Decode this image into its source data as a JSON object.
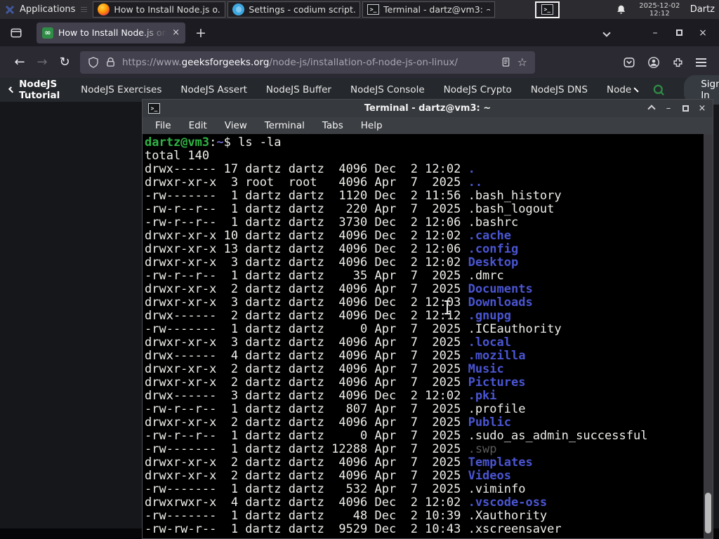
{
  "panel": {
    "applications_label": "Applications",
    "window_buttons": [
      {
        "label": "How to Install Node.js o...",
        "icon": "firefox"
      },
      {
        "label": "Settings - codium script...",
        "icon": "vscodium"
      },
      {
        "label": "Terminal - dartz@vm3: ~",
        "icon": "terminal"
      }
    ],
    "clock_date": "2025-12-02",
    "clock_time": "12:12",
    "user_label": "Dartz"
  },
  "browser": {
    "tab_title": "How to Install Node.js on",
    "url_scheme": "https://www.",
    "url_domain": "geeksforgeeks.org",
    "url_path": "/node-js/installation-of-node-js-on-linux/"
  },
  "gfg_nav": {
    "back_item": "NodeJS Tutorial",
    "items": [
      "NodeJS Exercises",
      "NodeJS Assert",
      "NodeJS Buffer",
      "NodeJS Console",
      "NodeJS Crypto",
      "NodeJS DNS",
      "Node"
    ],
    "sign_in_label": "Sign In"
  },
  "icons": {
    "gfg_favicon": "∞",
    "new_tab": "+",
    "close": "×",
    "minimize": "–",
    "back": "←",
    "forward": "→",
    "reload": "↻",
    "star": "☆",
    "terminal_glyph": ">_"
  },
  "terminal": {
    "title": "Terminal - dartz@vm3: ~",
    "menu": [
      "File",
      "Edit",
      "View",
      "Terminal",
      "Tabs",
      "Help"
    ],
    "prompt_user_host": "dartz@vm3",
    "prompt_cwd": "~",
    "command": "ls -la",
    "total_line": "total 140",
    "listing": [
      {
        "perm": "drwx------",
        "links": "17",
        "owner": "dartz",
        "group": "dartz",
        "size": "4096",
        "date": "Dec  2 12:02",
        "name": ".",
        "type": "dir"
      },
      {
        "perm": "drwxr-xr-x",
        "links": "3",
        "owner": "root",
        "group": "root",
        "size": "4096",
        "date": "Apr  7  2025",
        "name": "..",
        "type": "dir"
      },
      {
        "perm": "-rw-------",
        "links": "1",
        "owner": "dartz",
        "group": "dartz",
        "size": "1120",
        "date": "Dec  2 11:56",
        "name": ".bash_history",
        "type": "file"
      },
      {
        "perm": "-rw-r--r--",
        "links": "1",
        "owner": "dartz",
        "group": "dartz",
        "size": "220",
        "date": "Apr  7  2025",
        "name": ".bash_logout",
        "type": "file"
      },
      {
        "perm": "-rw-r--r--",
        "links": "1",
        "owner": "dartz",
        "group": "dartz",
        "size": "3730",
        "date": "Dec  2 12:06",
        "name": ".bashrc",
        "type": "file"
      },
      {
        "perm": "drwxr-xr-x",
        "links": "10",
        "owner": "dartz",
        "group": "dartz",
        "size": "4096",
        "date": "Dec  2 12:02",
        "name": ".cache",
        "type": "dir"
      },
      {
        "perm": "drwxr-xr-x",
        "links": "13",
        "owner": "dartz",
        "group": "dartz",
        "size": "4096",
        "date": "Dec  2 12:06",
        "name": ".config",
        "type": "dir"
      },
      {
        "perm": "drwxr-xr-x",
        "links": "3",
        "owner": "dartz",
        "group": "dartz",
        "size": "4096",
        "date": "Dec  2 12:02",
        "name": "Desktop",
        "type": "dir"
      },
      {
        "perm": "-rw-r--r--",
        "links": "1",
        "owner": "dartz",
        "group": "dartz",
        "size": "35",
        "date": "Apr  7  2025",
        "name": ".dmrc",
        "type": "file"
      },
      {
        "perm": "drwxr-xr-x",
        "links": "2",
        "owner": "dartz",
        "group": "dartz",
        "size": "4096",
        "date": "Apr  7  2025",
        "name": "Documents",
        "type": "dir"
      },
      {
        "perm": "drwxr-xr-x",
        "links": "3",
        "owner": "dartz",
        "group": "dartz",
        "size": "4096",
        "date": "Dec  2 12:03",
        "name": "Downloads",
        "type": "dir"
      },
      {
        "perm": "drwx------",
        "links": "2",
        "owner": "dartz",
        "group": "dartz",
        "size": "4096",
        "date": "Dec  2 12:12",
        "name": ".gnupg",
        "type": "dir"
      },
      {
        "perm": "-rw-------",
        "links": "1",
        "owner": "dartz",
        "group": "dartz",
        "size": "0",
        "date": "Apr  7  2025",
        "name": ".ICEauthority",
        "type": "file"
      },
      {
        "perm": "drwxr-xr-x",
        "links": "3",
        "owner": "dartz",
        "group": "dartz",
        "size": "4096",
        "date": "Apr  7  2025",
        "name": ".local",
        "type": "dir"
      },
      {
        "perm": "drwx------",
        "links": "4",
        "owner": "dartz",
        "group": "dartz",
        "size": "4096",
        "date": "Apr  7  2025",
        "name": ".mozilla",
        "type": "dir"
      },
      {
        "perm": "drwxr-xr-x",
        "links": "2",
        "owner": "dartz",
        "group": "dartz",
        "size": "4096",
        "date": "Apr  7  2025",
        "name": "Music",
        "type": "dir"
      },
      {
        "perm": "drwxr-xr-x",
        "links": "2",
        "owner": "dartz",
        "group": "dartz",
        "size": "4096",
        "date": "Apr  7  2025",
        "name": "Pictures",
        "type": "dir"
      },
      {
        "perm": "drwx------",
        "links": "3",
        "owner": "dartz",
        "group": "dartz",
        "size": "4096",
        "date": "Dec  2 12:02",
        "name": ".pki",
        "type": "dir"
      },
      {
        "perm": "-rw-r--r--",
        "links": "1",
        "owner": "dartz",
        "group": "dartz",
        "size": "807",
        "date": "Apr  7  2025",
        "name": ".profile",
        "type": "file"
      },
      {
        "perm": "drwxr-xr-x",
        "links": "2",
        "owner": "dartz",
        "group": "dartz",
        "size": "4096",
        "date": "Apr  7  2025",
        "name": "Public",
        "type": "dir"
      },
      {
        "perm": "-rw-r--r--",
        "links": "1",
        "owner": "dartz",
        "group": "dartz",
        "size": "0",
        "date": "Apr  7  2025",
        "name": ".sudo_as_admin_successful",
        "type": "file"
      },
      {
        "perm": "-rw-------",
        "links": "1",
        "owner": "dartz",
        "group": "dartz",
        "size": "12288",
        "date": "Apr  7  2025",
        "name": ".swp",
        "type": "dim"
      },
      {
        "perm": "drwxr-xr-x",
        "links": "2",
        "owner": "dartz",
        "group": "dartz",
        "size": "4096",
        "date": "Apr  7  2025",
        "name": "Templates",
        "type": "dir"
      },
      {
        "perm": "drwxr-xr-x",
        "links": "2",
        "owner": "dartz",
        "group": "dartz",
        "size": "4096",
        "date": "Apr  7  2025",
        "name": "Videos",
        "type": "dir"
      },
      {
        "perm": "-rw-------",
        "links": "1",
        "owner": "dartz",
        "group": "dartz",
        "size": "532",
        "date": "Apr  7  2025",
        "name": ".viminfo",
        "type": "file"
      },
      {
        "perm": "drwxrwxr-x",
        "links": "4",
        "owner": "dartz",
        "group": "dartz",
        "size": "4096",
        "date": "Dec  2 12:02",
        "name": ".vscode-oss",
        "type": "dir"
      },
      {
        "perm": "-rw-------",
        "links": "1",
        "owner": "dartz",
        "group": "dartz",
        "size": "48",
        "date": "Dec  2 10:39",
        "name": ".Xauthority",
        "type": "file"
      },
      {
        "perm": "-rw-rw-r--",
        "links": "1",
        "owner": "dartz",
        "group": "dartz",
        "size": "9529",
        "date": "Dec  2 10:43",
        "name": ".xscreensaver",
        "type": "file"
      }
    ]
  },
  "colors": {
    "panel_bg": "#2b2b30",
    "tabbar_bg": "#1c1b22",
    "tab_active_bg": "#42414d",
    "toolbar_bg": "#2b2a33",
    "page_bg": "#15171b",
    "gfg_nav_bg": "#25282c",
    "gfg_green": "#2f8d46",
    "term_titlebar_bg": "#36393d",
    "term_menubar_bg": "#3b3e42",
    "term_bg": "#000000",
    "term_fg": "#eeeeea",
    "prompt_green": "#2fb344",
    "prompt_path": "#6b66c2",
    "dir_blue": "#4a55d2",
    "dim_file": "#5a5a5a"
  }
}
